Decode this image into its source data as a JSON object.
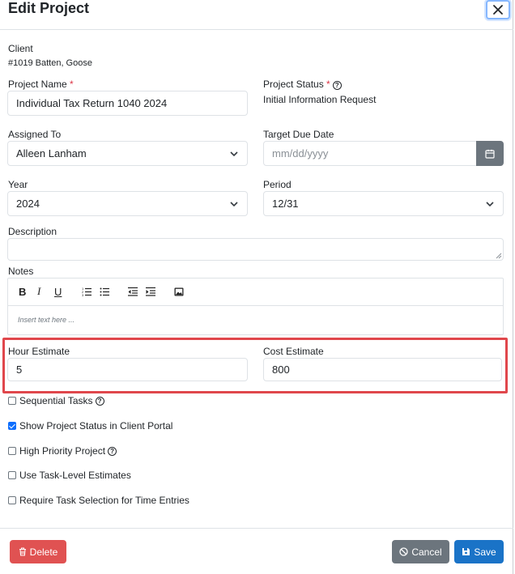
{
  "modal": {
    "title": "Edit Project",
    "close_icon": "close-icon"
  },
  "client": {
    "label": "Client",
    "value": "#1019 Batten, Goose"
  },
  "project_name": {
    "label": "Project Name",
    "required_mark": "*",
    "value": "Individual Tax Return 1040 2024"
  },
  "project_status": {
    "label": "Project Status",
    "required_mark": "*",
    "value": "Initial Information Request"
  },
  "assigned_to": {
    "label": "Assigned To",
    "value": "Alleen Lanham"
  },
  "target_due_date": {
    "label": "Target Due Date",
    "placeholder": "mm/dd/yyyy"
  },
  "year": {
    "label": "Year",
    "value": "2024"
  },
  "period": {
    "label": "Period",
    "value": "12/31"
  },
  "description": {
    "label": "Description",
    "value": ""
  },
  "notes": {
    "label": "Notes",
    "placeholder": "Insert text here ...",
    "toolbar": [
      "bold-icon",
      "italic-icon",
      "underline-icon",
      "ordered-list-icon",
      "unordered-list-icon",
      "outdent-icon",
      "indent-icon",
      "image-icon"
    ]
  },
  "hour_estimate": {
    "label": "Hour Estimate",
    "value": "5"
  },
  "cost_estimate": {
    "label": "Cost Estimate",
    "value": "800"
  },
  "options": [
    {
      "label": "Sequential Tasks",
      "checked": false,
      "help": true
    },
    {
      "label": "Show Project Status in Client Portal",
      "checked": true,
      "help": false
    },
    {
      "label": "High Priority Project",
      "checked": false,
      "help": true
    },
    {
      "label": "Use Task-Level Estimates",
      "checked": false,
      "help": false
    },
    {
      "label": "Require Task Selection for Time Entries",
      "checked": false,
      "help": false
    }
  ],
  "footer": {
    "delete_label": "Delete",
    "cancel_label": "Cancel",
    "save_label": "Save"
  },
  "colors": {
    "delete": "#e05252",
    "cancel": "#6c757d",
    "save": "#0d6efd",
    "highlight": "#e0474c",
    "checkbox_checked": "#0d6efd"
  }
}
